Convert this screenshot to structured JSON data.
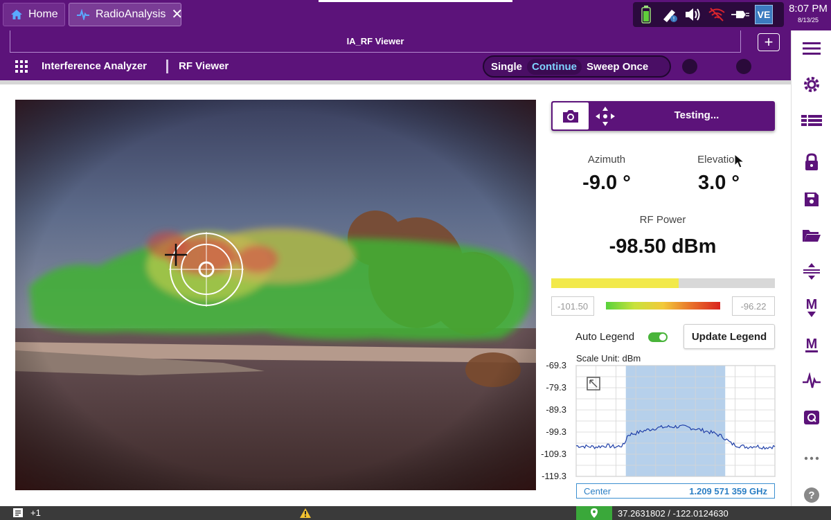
{
  "os": {
    "tabs": [
      {
        "label": "Home",
        "icon": "home-icon"
      },
      {
        "label": "RadioAnalysis",
        "icon": "waveform-icon"
      }
    ],
    "tray_badge": "VE",
    "time": "8:07 PM",
    "date": "8/13/25"
  },
  "app": {
    "window_title": "IA_RF Viewer",
    "breadcrumb": [
      "Interference Analyzer",
      "RF Viewer"
    ],
    "modes": [
      "Single",
      "Continue",
      "Sweep Once"
    ],
    "active_mode": "Continue"
  },
  "panel": {
    "status": "Testing...",
    "azimuth_label": "Azimuth",
    "azimuth_value": "-9.0 °",
    "elevation_label": "Elevation",
    "elevation_value": "3.0 °",
    "rf_power_label": "RF Power",
    "rf_power_value": "-98.50 dBm",
    "power_bar_fraction": 0.57,
    "legend_min": "-101.50",
    "legend_max": "-96.22",
    "auto_legend_label": "Auto Legend",
    "auto_legend_on": true,
    "update_legend_label": "Update Legend",
    "scale_unit": "Scale Unit: dBm",
    "center_label": "Center",
    "center_value": "1.209 571 359 GHz"
  },
  "chart_data": {
    "type": "line",
    "title": "",
    "xlabel": "",
    "ylabel": "",
    "y_ticks": [
      "-69.3",
      "-79.3",
      "-89.3",
      "-99.3",
      "-109.3",
      "-119.3"
    ],
    "ylim": [
      -119.3,
      -69.3
    ],
    "grid": true,
    "highlight_band": [
      0.25,
      0.75
    ],
    "series": [
      {
        "color": "#1f3fa8",
        "x": [
          0,
          0.05,
          0.1,
          0.15,
          0.2,
          0.24,
          0.26,
          0.3,
          0.35,
          0.4,
          0.45,
          0.5,
          0.55,
          0.6,
          0.65,
          0.7,
          0.74,
          0.78,
          0.82,
          0.86,
          0.9,
          0.95,
          1.0
        ],
        "values": [
          -105.5,
          -105.8,
          -106.0,
          -105.4,
          -106.0,
          -105.2,
          -100.5,
          -99.8,
          -98.5,
          -97.5,
          -97.0,
          -96.8,
          -97.0,
          -97.8,
          -98.8,
          -100.0,
          -101.5,
          -104.5,
          -105.5,
          -106.0,
          -105.6,
          -106.2,
          -105.8
        ]
      }
    ]
  },
  "statusbar": {
    "messages": "+1",
    "coordinates": "37.2631802 / -122.0124630"
  },
  "sidebar": [
    "menu-icon",
    "settings-icon",
    "layout-icon",
    "lock-icon",
    "save-icon",
    "folder-icon",
    "adjust-icon",
    "marker-down-icon",
    "marker-up-icon",
    "trace-icon",
    "screenshot-icon",
    "more-icon",
    "help-icon"
  ]
}
